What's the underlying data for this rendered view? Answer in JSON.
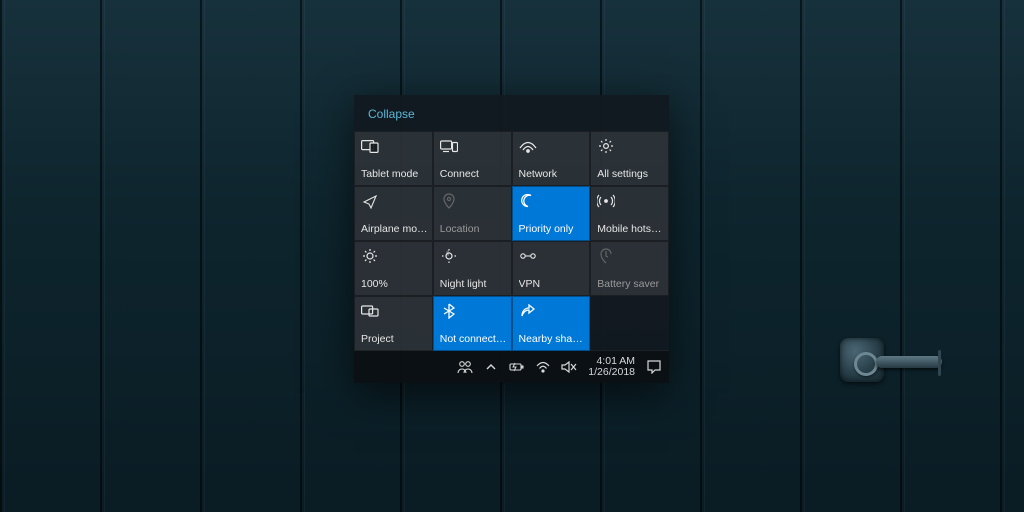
{
  "action_center": {
    "collapse_label": "Collapse",
    "tiles": [
      {
        "icon": "tablet-icon",
        "label": "Tablet mode",
        "state": "normal"
      },
      {
        "icon": "connect-icon",
        "label": "Connect",
        "state": "normal"
      },
      {
        "icon": "network-icon",
        "label": "Network",
        "state": "normal"
      },
      {
        "icon": "settings-icon",
        "label": "All settings",
        "state": "normal"
      },
      {
        "icon": "airplane-icon",
        "label": "Airplane mode",
        "state": "normal"
      },
      {
        "icon": "location-icon",
        "label": "Location",
        "state": "dim"
      },
      {
        "icon": "moon-icon",
        "label": "Priority only",
        "state": "active"
      },
      {
        "icon": "hotspot-icon",
        "label": "Mobile hotspot",
        "state": "normal"
      },
      {
        "icon": "brightness-icon",
        "label": "100%",
        "state": "normal"
      },
      {
        "icon": "nightlight-icon",
        "label": "Night light",
        "state": "normal"
      },
      {
        "icon": "vpn-icon",
        "label": "VPN",
        "state": "normal"
      },
      {
        "icon": "battery-icon",
        "label": "Battery saver",
        "state": "dim"
      },
      {
        "icon": "project-icon",
        "label": "Project",
        "state": "normal"
      },
      {
        "icon": "bluetooth-icon",
        "label": "Not connected",
        "state": "active"
      },
      {
        "icon": "share-icon",
        "label": "Nearby sharing",
        "state": "active"
      },
      {
        "icon": "",
        "label": "",
        "state": "empty"
      }
    ]
  },
  "taskbar": {
    "time": "4:01 AM",
    "date": "1/26/2018"
  }
}
